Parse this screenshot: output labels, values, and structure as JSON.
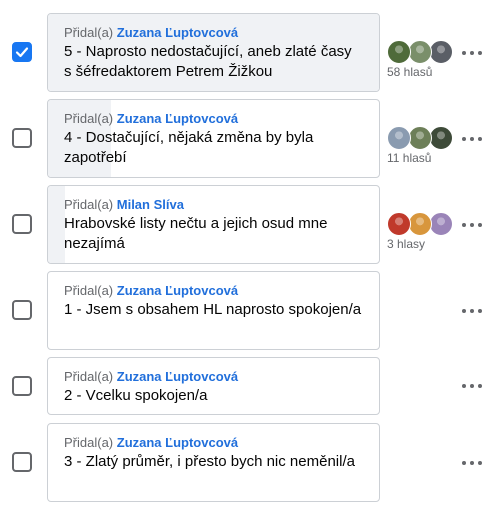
{
  "poll": {
    "added_prefix": "Přidal(a)",
    "options": [
      {
        "author": "Zuzana Ľuptovcová",
        "text": "5 - Naprosto nedostačující, aneb zlaté časy s šéfredaktorem Petrem Žižkou",
        "checked": true,
        "vote_fraction": 1.0,
        "votes_label": "58 hlasů",
        "avatar_colors": [
          "#4f6b3a",
          "#7a8f6a",
          "#5a5e66"
        ]
      },
      {
        "author": "Zuzana Ľuptovcová",
        "text": "4 - Dostačující, nějaká změna by byla zapotřebí",
        "checked": false,
        "vote_fraction": 0.19,
        "votes_label": "11 hlasů",
        "avatar_colors": [
          "#8a9bb0",
          "#6d7f58",
          "#3d4a38"
        ]
      },
      {
        "author": "Milan Slíva",
        "text": "Hrabovské listy nečtu a jejich osud mne nezajímá",
        "checked": false,
        "vote_fraction": 0.05,
        "votes_label": "3 hlasy",
        "avatar_colors": [
          "#c0392b",
          "#d8963c",
          "#9a84b8"
        ]
      },
      {
        "author": "Zuzana Ľuptovcová",
        "text": "1 - Jsem s obsahem HL naprosto spokojen/a",
        "checked": false,
        "vote_fraction": 0,
        "votes_label": "",
        "avatar_colors": []
      },
      {
        "author": "Zuzana Ľuptovcová",
        "text": "2 - Vcelku spokojen/a",
        "checked": false,
        "vote_fraction": 0,
        "votes_label": "",
        "avatar_colors": []
      },
      {
        "author": "Zuzana Ľuptovcová",
        "text": "3 - Zlatý průměr, i přesto bych nic neměnil/a",
        "checked": false,
        "vote_fraction": 0,
        "votes_label": "",
        "avatar_colors": []
      }
    ]
  },
  "icons": {
    "checkmark": "check-icon",
    "more": "more-options-icon"
  }
}
